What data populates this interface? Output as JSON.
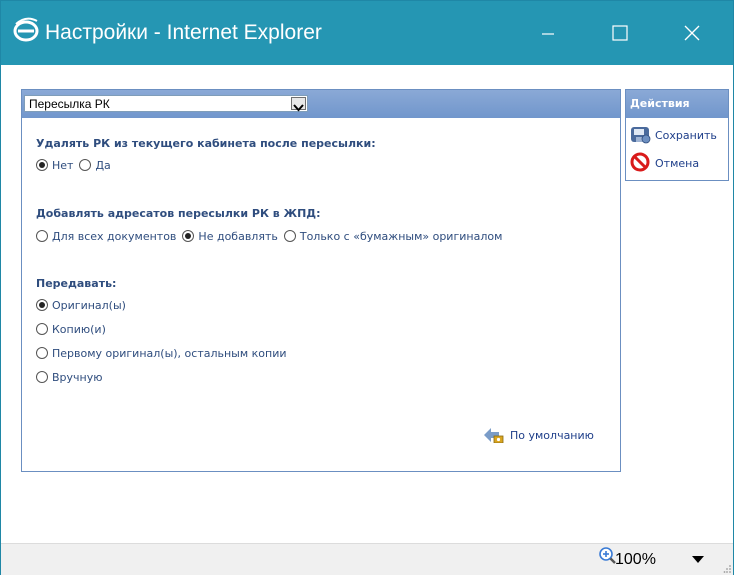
{
  "window": {
    "title": "Настройки - Internet Explorer",
    "brand_color": "#2596b3",
    "icons": [
      "ie-logo-icon",
      "minimize-icon",
      "maximize-icon",
      "close-icon"
    ]
  },
  "settings": {
    "section_select": {
      "value": "Пересылка РК"
    },
    "delete_after_forward": {
      "label": "Удалять РК из текущего кабинета после пересылки:",
      "options": [
        "Нет",
        "Да"
      ],
      "selected": "Нет"
    },
    "add_recipients": {
      "label": "Добавлять адресатов пересылки РК в ЖПД:",
      "options": [
        "Для всех документов",
        "Не добавлять",
        "Только с «бумажным» оригиналом"
      ],
      "selected": "Не добавлять"
    },
    "transfer": {
      "label": "Передавать:",
      "options": [
        "Оригинал(ы)",
        "Копию(и)",
        "Первому оригинал(ы), остальным копии",
        "Вручную"
      ],
      "selected": "Оригинал(ы)"
    },
    "default_link": "По умолчанию"
  },
  "actions": {
    "title": "Действия",
    "save": "Сохранить",
    "cancel": "Отмена"
  },
  "statusbar": {
    "zoom": "100%"
  }
}
